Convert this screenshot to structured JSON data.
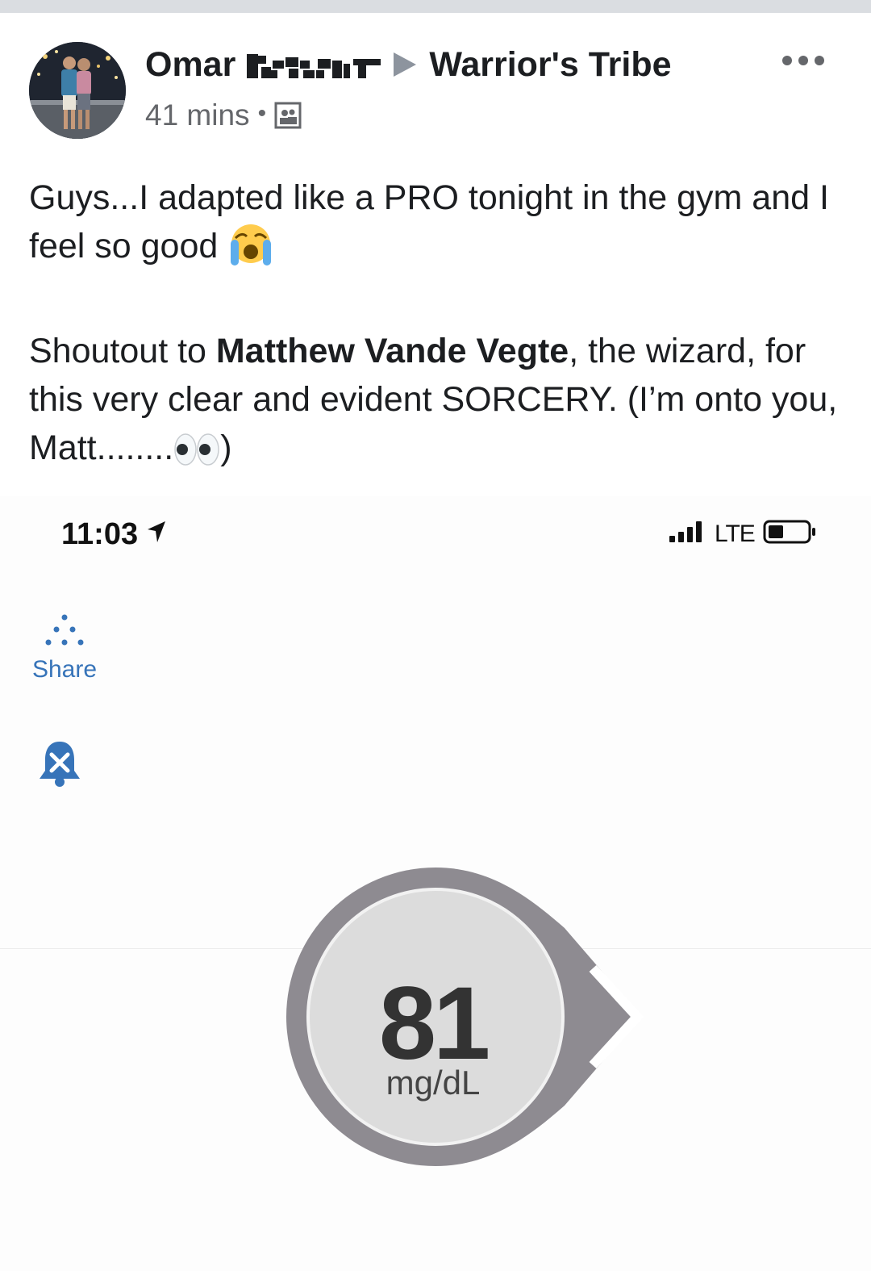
{
  "post": {
    "author_first_name": "Omar",
    "group_name": "Warrior's Tribe",
    "timestamp": "41 mins",
    "separator": "•",
    "line1": "Guys...I adapted like a PRO tonight in the gym and I feel so good",
    "shoutout_prefix": "Shoutout to ",
    "mention": "Matthew Vande Vegte",
    "shoutout_rest": ", the wizard, for this very clear and evident SORCERY. (I’m onto you, Matt........",
    "shoutout_close": ")"
  },
  "screenshot": {
    "status_time": "11:03",
    "network": "LTE",
    "share_label": "Share",
    "glucose_value": "81",
    "glucose_unit": "mg/dL"
  },
  "icons": {
    "more": "more-horizontal-icon",
    "audience": "group-photo-icon",
    "emoji1": "loudly-crying-face-emoji",
    "emoji2": "eyes-emoji",
    "location": "location-arrow-icon",
    "signal": "cell-signal-icon",
    "battery": "battery-icon",
    "share": "share-dots-icon",
    "alert": "alert-bell-icon",
    "trend": "trend-arrow-icon"
  },
  "colors": {
    "link_blue": "#3774b9",
    "gauge_ring": "#8e8b91",
    "gauge_fill": "#dcdcdc"
  }
}
